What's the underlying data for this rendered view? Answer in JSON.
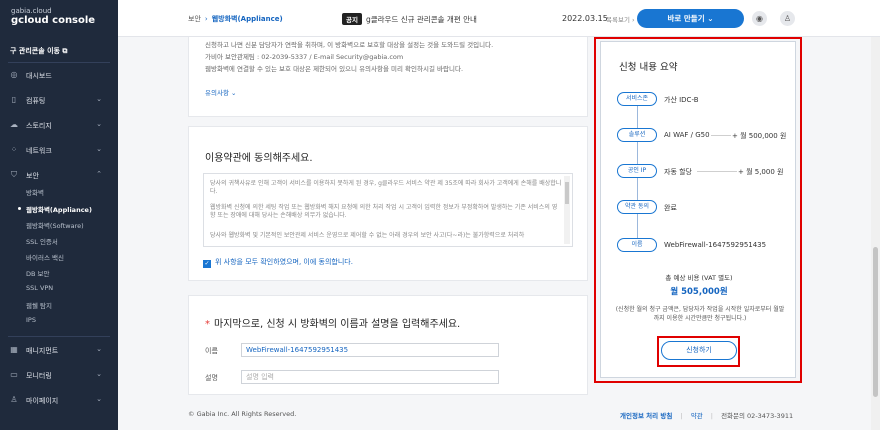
{
  "brand": {
    "line1": "gabia.cloud",
    "line2": "gcloud console"
  },
  "sidebar": {
    "legacy_link": "구 관리콘솔 이동",
    "items": [
      {
        "label": "대시보드",
        "icon": "dashboard-icon"
      },
      {
        "label": "컴퓨팅",
        "icon": "server-icon"
      },
      {
        "label": "스토리지",
        "icon": "cloud-icon"
      },
      {
        "label": "네트워크",
        "icon": "network-icon"
      },
      {
        "label": "보안",
        "icon": "shield-icon"
      },
      {
        "label": "매니지먼트",
        "icon": "grid-icon"
      },
      {
        "label": "모니터링",
        "icon": "monitor-icon"
      },
      {
        "label": "마이페이지",
        "icon": "user-icon"
      }
    ],
    "security_sub": [
      "방화벽",
      "웹방화벽(Appliance)",
      "웹방화벽(Software)",
      "SSL 인증서",
      "바이러스 백신",
      "DB 보안",
      "SSL VPN",
      "웹쉘 탐지",
      "IPS"
    ]
  },
  "topbar": {
    "crumb_parent": "보안",
    "crumb_arrow": "›",
    "crumb_current": "웹방화벽(Appliance)",
    "notice_tag": "공지",
    "notice_text": "g클라우드 신규 관리콘솔 개편 안내",
    "date": "2022.03.15",
    "more": "목록보기 ›",
    "make_button": "바로 만들기  ⌄"
  },
  "info": {
    "lines": [
      "신청하고 나면 신분 담당자가 연락을 취하며, 이 방화벽으로 보호할 대상을 설정는 것을 도와드릴 것입니다.",
      "가비아 보안관제팀 : 02-2039-5337 / E-mail Security@gabia.com",
      "웹방화벽에 연결할 수 있는 보호 대상은 제한되어 있으니 유의사항을 미리 확인하시길 바랍니다."
    ],
    "notice_link": "유의사항 ⌄"
  },
  "terms": {
    "heading": "이용약관에 동의해주세요.",
    "paragraphs": [
      "당사의 귀책사유로 인해 고객이 서비스를 이용하지 못하게 된 경우, g클라우드 서비스 약관 제 35조에 따라 회사가 고객에게 손해를 배상합니다.",
      "웹방화벽 신청에 의한 세팅 작업 또는 웹방화벽 해지 요청에 의한 처리 작업 시 고객이 입력한 정보가 부정확하여 발생하는 기존 서비스의 영향 또는 장애에 대해 당사는 손해배상 의무가 없습니다.",
      "당사와 웹방화벽 및 기본적인 보안관제 서비스 운영으로 제어할 수 없는 아래 경우의 보안 사고(다~라)는 불가항력으로 처리하"
    ],
    "agree_text": "위 사항을 모두 확인하였으며, 이에 동의합니다."
  },
  "final": {
    "required_mark": "*",
    "heading": "마지막으로, 신청 시 방화벽의 이름과 설명을 입력해주세요.",
    "name_label": "이름",
    "name_value": "WebFirewall-1647592951435",
    "desc_label": "설명",
    "desc_placeholder": "설명 입력"
  },
  "summary": {
    "title": "신청 내용 요약",
    "rows": [
      {
        "pill": "서비스존",
        "value": "가산 IDC-B",
        "price": ""
      },
      {
        "pill": "솔루션",
        "value": "AI WAF / G50",
        "price": "+ 월 500,000 원"
      },
      {
        "pill": "공인 IP",
        "value": "자동 할당",
        "price": "+ 월 5,000 원"
      },
      {
        "pill": "약관 동의",
        "value": "완료",
        "price": ""
      },
      {
        "pill": "이름",
        "value": "WebFirewall-1647592951435",
        "price": ""
      }
    ],
    "total_label": "총 예상 비용 (VAT 별도)",
    "total_value": "월 505,000원",
    "note": "(신청한 월의 청구 금액은, 담당자가 작업을 시작한 일자로부터 월말까지 이용한 시간만큼만 청구됩니다.)",
    "apply_button": "신청하기"
  },
  "footer": {
    "copyright": "© Gabia Inc. All Rights Reserved.",
    "privacy": "개인정보 처리 방침",
    "terms": "약관",
    "divider": "|",
    "contact": "전화문의  02-3473-3911"
  },
  "colors": {
    "accent": "#1976d2",
    "sidebar": "#1f2a3c",
    "highlight": "#e00000"
  }
}
